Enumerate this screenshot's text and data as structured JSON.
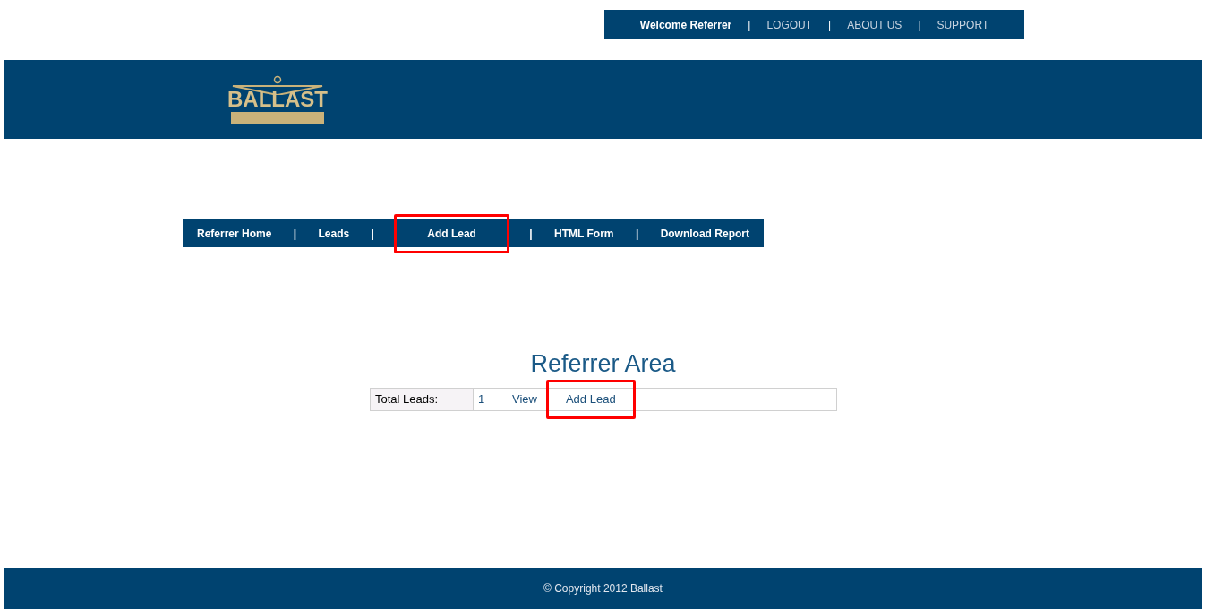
{
  "top_bar": [
    {
      "kind": "welcome",
      "text": "Welcome Referrer"
    },
    {
      "kind": "separator",
      "text": "|"
    },
    {
      "kind": "link",
      "text": "LOGOUT"
    },
    {
      "kind": "separator",
      "text": "|"
    },
    {
      "kind": "link",
      "text": "ABOUT US"
    },
    {
      "kind": "separator",
      "text": "|"
    },
    {
      "kind": "link",
      "text": "SUPPORT"
    }
  ],
  "logo": {
    "text": "BALLAST"
  },
  "nav": [
    {
      "kind": "link",
      "text": "Referrer Home",
      "highlighted": false
    },
    {
      "kind": "separator",
      "text": "|"
    },
    {
      "kind": "link",
      "text": "Leads",
      "highlighted": false
    },
    {
      "kind": "separator",
      "text": "|"
    },
    {
      "kind": "link",
      "text": "Add Lead",
      "highlighted": true
    },
    {
      "kind": "separator",
      "text": "|"
    },
    {
      "kind": "link",
      "text": "HTML Form",
      "highlighted": false
    },
    {
      "kind": "separator",
      "text": "|"
    },
    {
      "kind": "link",
      "text": "Download Report",
      "highlighted": false
    }
  ],
  "title": "Referrer Area",
  "summary": {
    "label": "Total Leads:",
    "count": "1",
    "links": [
      {
        "text": "View",
        "highlighted": false
      },
      {
        "text": "Add Lead",
        "highlighted": true
      }
    ]
  },
  "footer": "© Copyright 2012 Ballast"
}
